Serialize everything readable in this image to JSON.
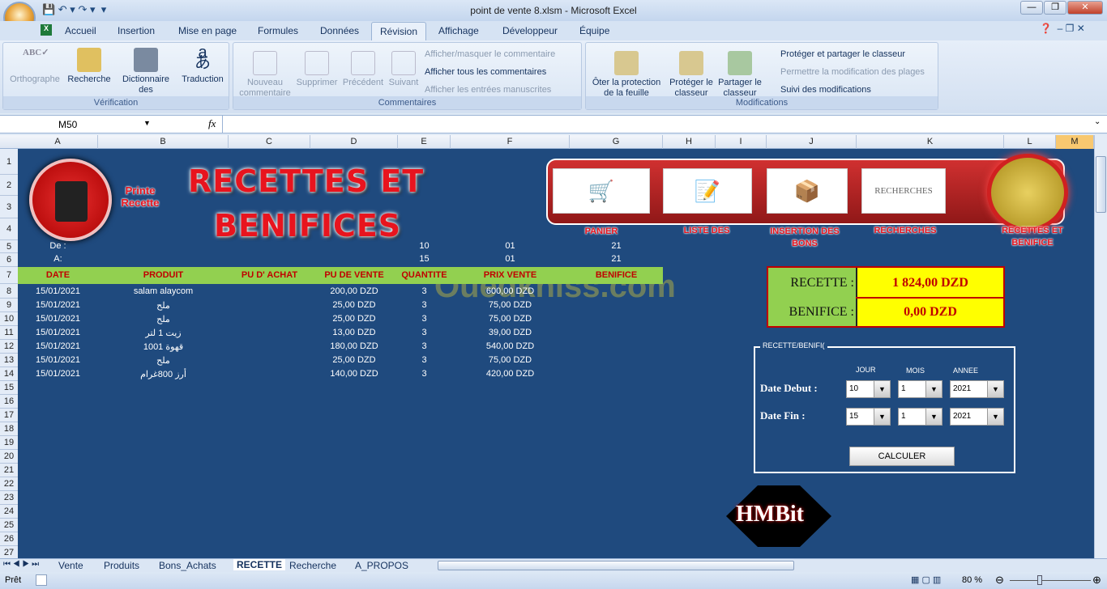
{
  "window": {
    "title": "point de vente 8.xlsm - Microsoft Excel",
    "minimize": "—",
    "restore": "❐",
    "close": "✕"
  },
  "ribbon_tabs": [
    "Accueil",
    "Insertion",
    "Mise en page",
    "Formules",
    "Données",
    "Révision",
    "Affichage",
    "Développeur",
    "Équipe"
  ],
  "active_tab": "Révision",
  "ribbon": {
    "verification": {
      "label": "Vérification",
      "buttons": [
        "Orthographe",
        "Recherche",
        "Dictionnaire des synonymes",
        "Traduction"
      ]
    },
    "commentaires": {
      "label": "Commentaires",
      "buttons": [
        "Nouveau commentaire",
        "Supprimer",
        "Précédent",
        "Suivant"
      ],
      "small": [
        "Afficher/masquer le commentaire",
        "Afficher tous les commentaires",
        "Afficher les entrées manuscrites"
      ]
    },
    "modifications": {
      "label": "Modifications",
      "buttons": [
        "Ôter la protection de la feuille",
        "Protéger le classeur",
        "Partager le classeur"
      ],
      "small": [
        "Protéger et partager le classeur",
        "Permettre la modification des plages",
        "Suivi des modifications"
      ]
    }
  },
  "formula_bar": {
    "name_box": "M50",
    "fx": "fx",
    "value": ""
  },
  "columns": [
    "A",
    "B",
    "C",
    "D",
    "E",
    "F",
    "G",
    "H",
    "I",
    "J",
    "K",
    "L",
    "M"
  ],
  "rows": [
    "1",
    "2",
    "3",
    "4",
    "5",
    "6",
    "7",
    "8",
    "9",
    "10",
    "11",
    "12",
    "13",
    "14",
    "15",
    "16",
    "17",
    "18",
    "19",
    "20",
    "21",
    "22",
    "23",
    "24",
    "25",
    "26",
    "27"
  ],
  "sheet": {
    "printer_label": "Printe Recette",
    "title_line1": "RECETTES ET",
    "title_line2": "BENIFICES",
    "nav": [
      "PANIER",
      "LISTE DES",
      "INSERTION DES BONS",
      "RECHERCHES",
      "RECETTES ET BENIFICE"
    ],
    "nav_thumb_text": "RECHERCHES",
    "de_label": "De :",
    "a_label": "A:",
    "de": [
      "10",
      "01",
      "21"
    ],
    "a": [
      "15",
      "01",
      "21"
    ],
    "headers": [
      "DATE",
      "PRODUIT",
      "PU D' ACHAT",
      "PU DE VENTE",
      "QUANTITE",
      "PRIX VENTE",
      "BENIFICE"
    ],
    "rows": [
      [
        "15/01/2021",
        "salam alaycom",
        "",
        "200,00 DZD",
        "3",
        "600,00 DZD",
        ""
      ],
      [
        "15/01/2021",
        "ملح",
        "",
        "25,00 DZD",
        "3",
        "75,00 DZD",
        ""
      ],
      [
        "15/01/2021",
        "ملح",
        "",
        "25,00 DZD",
        "3",
        "75,00 DZD",
        ""
      ],
      [
        "15/01/2021",
        "زيت 1 لتر",
        "",
        "13,00 DZD",
        "3",
        "39,00 DZD",
        ""
      ],
      [
        "15/01/2021",
        "قهوة 1001",
        "",
        "180,00 DZD",
        "3",
        "540,00 DZD",
        ""
      ],
      [
        "15/01/2021",
        "ملح",
        "",
        "25,00 DZD",
        "3",
        "75,00 DZD",
        ""
      ],
      [
        "15/01/2021",
        "أرز 800غرام",
        "",
        "140,00 DZD",
        "3",
        "420,00 DZD",
        ""
      ]
    ],
    "recette_label": "RECETTE :",
    "recette_value": "1 824,00 DZD",
    "benifice_label": "BENIFICE :",
    "benifice_value": "0,00 DZD",
    "form": {
      "legend": "RECETTE/BENIFI(",
      "jour": "JOUR",
      "mois": "MOIS",
      "annee": "ANNEE",
      "debut_label": "Date Debut :",
      "fin_label": "Date Fin :",
      "debut": [
        "10",
        "1",
        "2021"
      ],
      "fin": [
        "15",
        "1",
        "2021"
      ],
      "button": "CALCULER"
    },
    "logo": "HMBit",
    "watermark": "Ouedkniss.com"
  },
  "sheet_tabs": [
    "Vente",
    "Produits",
    "Bons_Achats",
    "RECETTE",
    "Recherche",
    "A_PROPOS"
  ],
  "active_sheet": "RECETTE",
  "status": {
    "ready": "Prêt",
    "zoom": "80 %"
  }
}
